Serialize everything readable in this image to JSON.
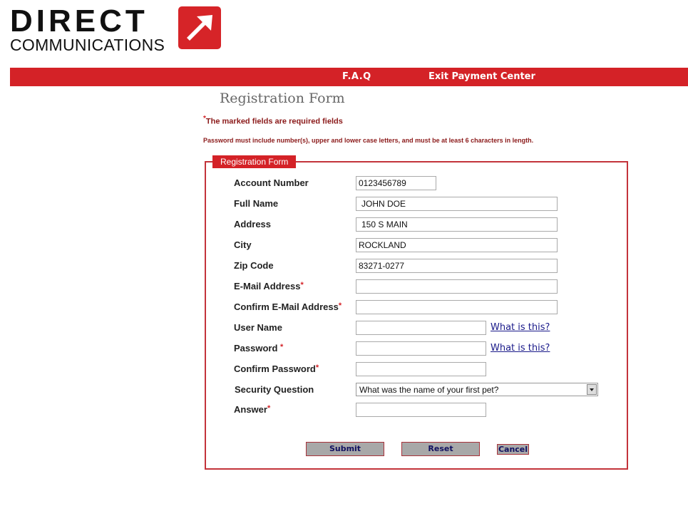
{
  "brand": {
    "name_top": "DIRECT",
    "name_bottom": "COMMUNICATIONS",
    "accent": "#d42227"
  },
  "nav": {
    "faq": "F.A.Q",
    "exit": "Exit Payment Center"
  },
  "page_title": "Registration Form",
  "required_note": "The marked fields are required fields",
  "required_star": "*",
  "password_note": "Password must include number(s), upper and lower case letters, and must be at least 6 characters in length.",
  "form": {
    "legend": "Registration Form",
    "fields": {
      "account_number": {
        "label": "Account Number",
        "value": "0123456789"
      },
      "full_name": {
        "label": "Full Name",
        "value": "JOHN DOE"
      },
      "address": {
        "label": "Address",
        "value": "150 S MAIN"
      },
      "city": {
        "label": "City",
        "value": "ROCKLAND"
      },
      "zip": {
        "label": "Zip Code",
        "value": "83271-0277"
      },
      "email": {
        "label": "E-Mail Address",
        "value": ""
      },
      "confirm_email": {
        "label": "Confirm E-Mail Address",
        "value": ""
      },
      "username": {
        "label": "User Name",
        "value": ""
      },
      "password": {
        "label": "Password ",
        "value": ""
      },
      "confirm_password": {
        "label": "Confirm Password",
        "value": ""
      },
      "security_question": {
        "label": "Security Question",
        "value": "What was the name of your first pet?"
      },
      "answer": {
        "label": "Answer",
        "value": ""
      }
    },
    "help_link": "What is this?",
    "buttons": {
      "submit": "Submit",
      "reset": "Reset",
      "cancel": "Cancel"
    }
  }
}
